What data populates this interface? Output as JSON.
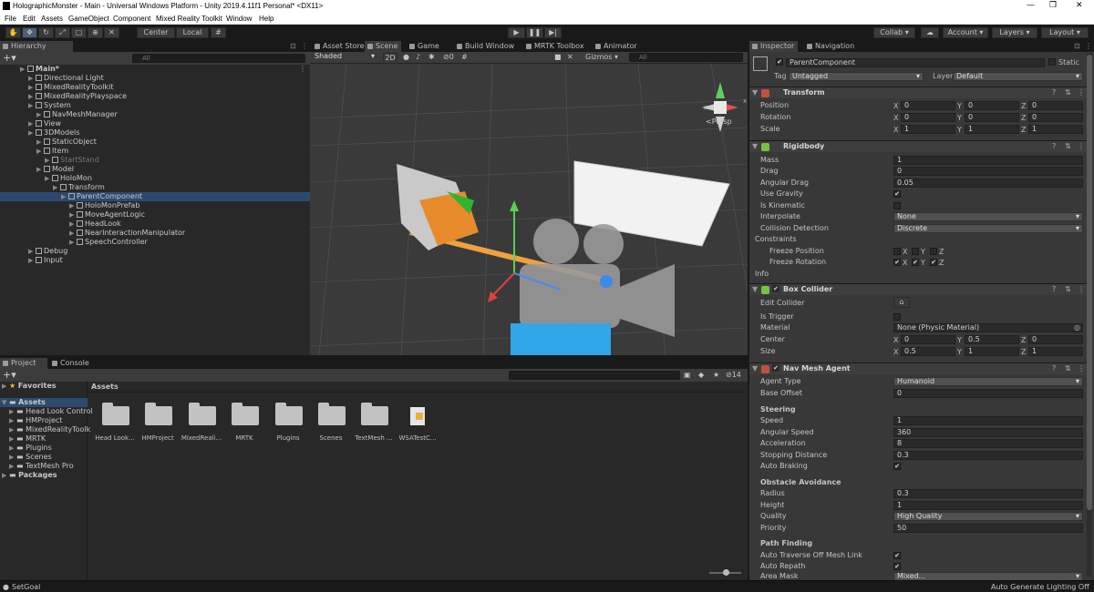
{
  "window": {
    "title": "HolographicMonster - Main - Universal Windows Platform - Unity 2019.4.11f1 Personal* <DX11>"
  },
  "menu": [
    "File",
    "Edit",
    "Assets",
    "GameObject",
    "Component",
    "Mixed Reality Toolkit",
    "Window",
    "Help"
  ],
  "toolbar": {
    "center": "Center",
    "local": "Local",
    "collab": "Collab",
    "account": "Account",
    "layers": "Layers",
    "layout": "Layout"
  },
  "hierarchy": {
    "tab": "Hierarchy",
    "search_placeholder": "All",
    "items": [
      {
        "label": "Main*",
        "depth": 0,
        "bold": true
      },
      {
        "label": "Directional Light",
        "depth": 1
      },
      {
        "label": "MixedRealityToolkit",
        "depth": 1
      },
      {
        "label": "MixedRealityPlayspace",
        "depth": 1
      },
      {
        "label": "System",
        "depth": 1
      },
      {
        "label": "NavMeshManager",
        "depth": 2
      },
      {
        "label": "View",
        "depth": 1
      },
      {
        "label": "3DModels",
        "depth": 1
      },
      {
        "label": "StaticObject",
        "depth": 2
      },
      {
        "label": "Item",
        "depth": 2
      },
      {
        "label": "StartStand",
        "depth": 3,
        "dim": true
      },
      {
        "label": "Model",
        "depth": 2
      },
      {
        "label": "HoloMon",
        "depth": 3
      },
      {
        "label": "Transform",
        "depth": 4
      },
      {
        "label": "ParentComponent",
        "depth": 5,
        "selected": true
      },
      {
        "label": "HoloMonPrefab",
        "depth": 6
      },
      {
        "label": "MoveAgentLogic",
        "depth": 6
      },
      {
        "label": "HeadLook",
        "depth": 6
      },
      {
        "label": "NearInteractionManipulator",
        "depth": 6
      },
      {
        "label": "SpeechController",
        "depth": 6
      },
      {
        "label": "Debug",
        "depth": 1
      },
      {
        "label": "Input",
        "depth": 1
      }
    ]
  },
  "scene": {
    "tabs": [
      "Asset Store",
      "Scene",
      "Game",
      "Build Window",
      "MRTK Toolbox",
      "Animator"
    ],
    "shading": "Shaded",
    "mode_2d": "2D",
    "hidden_count": "0",
    "gizmos": "Gizmos",
    "search_placeholder": "All",
    "persp": "Persp"
  },
  "project": {
    "tabs": [
      "Project",
      "Console"
    ],
    "favorites": "Favorites",
    "assets_root": "Assets",
    "tree": [
      "Head Look Control",
      "HMProject",
      "MixedRealityToolk",
      "MRTK",
      "Plugins",
      "Scenes",
      "TextMesh Pro"
    ],
    "packages": "Packages",
    "breadcrumb": "Assets",
    "hidden_count": "14",
    "files": [
      "Head Look...",
      "HMProject",
      "MixedReali...",
      "MRTK",
      "Plugins",
      "Scenes",
      "TextMesh ...",
      "WSATestC..."
    ]
  },
  "inspector": {
    "tabs": [
      "Inspector",
      "Navigation"
    ],
    "name": "ParentComponent",
    "static": "Static",
    "tag_label": "Tag",
    "tag": "Untagged",
    "layer_label": "Layer",
    "layer": "Default",
    "transform": {
      "title": "Transform",
      "position": {
        "label": "Position",
        "x": "0",
        "y": "0",
        "z": "0"
      },
      "rotation": {
        "label": "Rotation",
        "x": "0",
        "y": "0",
        "z": "0"
      },
      "scale": {
        "label": "Scale",
        "x": "1",
        "y": "1",
        "z": "1"
      }
    },
    "rigidbody": {
      "title": "Rigidbody",
      "mass": {
        "label": "Mass",
        "value": "1"
      },
      "drag": {
        "label": "Drag",
        "value": "0"
      },
      "angular_drag": {
        "label": "Angular Drag",
        "value": "0.05"
      },
      "use_gravity": {
        "label": "Use Gravity",
        "value": "✔"
      },
      "is_kinematic": {
        "label": "Is Kinematic",
        "value": ""
      },
      "interpolate": {
        "label": "Interpolate",
        "value": "None"
      },
      "collision": {
        "label": "Collision Detection",
        "value": "Discrete"
      },
      "constraints": "Constraints",
      "freeze_position": "Freeze Position",
      "freeze_rotation": "Freeze Rotation",
      "info": "Info"
    },
    "box_collider": {
      "title": "Box Collider",
      "edit": "Edit Collider",
      "is_trigger": "Is Trigger",
      "material": {
        "label": "Material",
        "value": "None (Physic Material)"
      },
      "center": {
        "label": "Center",
        "x": "0",
        "y": "0.5",
        "z": "0"
      },
      "size": {
        "label": "Size",
        "x": "0.5",
        "y": "1",
        "z": "1"
      }
    },
    "nav_mesh_agent": {
      "title": "Nav Mesh Agent",
      "agent_type": {
        "label": "Agent Type",
        "value": "Humanoid"
      },
      "base_offset": {
        "label": "Base Offset",
        "value": "0"
      },
      "steering": "Steering",
      "speed": {
        "label": "Speed",
        "value": "1"
      },
      "angular_speed": {
        "label": "Angular Speed",
        "value": "360"
      },
      "acceleration": {
        "label": "Acceleration",
        "value": "8"
      },
      "stopping": {
        "label": "Stopping Distance",
        "value": "0.3"
      },
      "auto_braking": {
        "label": "Auto Braking",
        "value": "✔"
      },
      "obstacle": "Obstacle Avoidance",
      "radius": {
        "label": "Radius",
        "value": "0.3"
      },
      "height": {
        "label": "Height",
        "value": "1"
      },
      "quality": {
        "label": "Quality",
        "value": "High Quality"
      },
      "priority": {
        "label": "Priority",
        "value": "50"
      },
      "path": "Path Finding",
      "auto_traverse": {
        "label": "Auto Traverse Off Mesh Link",
        "value": "✔"
      },
      "auto_repath": {
        "label": "Auto Repath",
        "value": "✔"
      },
      "area_mask": {
        "label": "Area Mask",
        "value": "Mixed..."
      }
    }
  },
  "status": {
    "left": "SetGoal",
    "right": "Auto Generate Lighting Off"
  }
}
